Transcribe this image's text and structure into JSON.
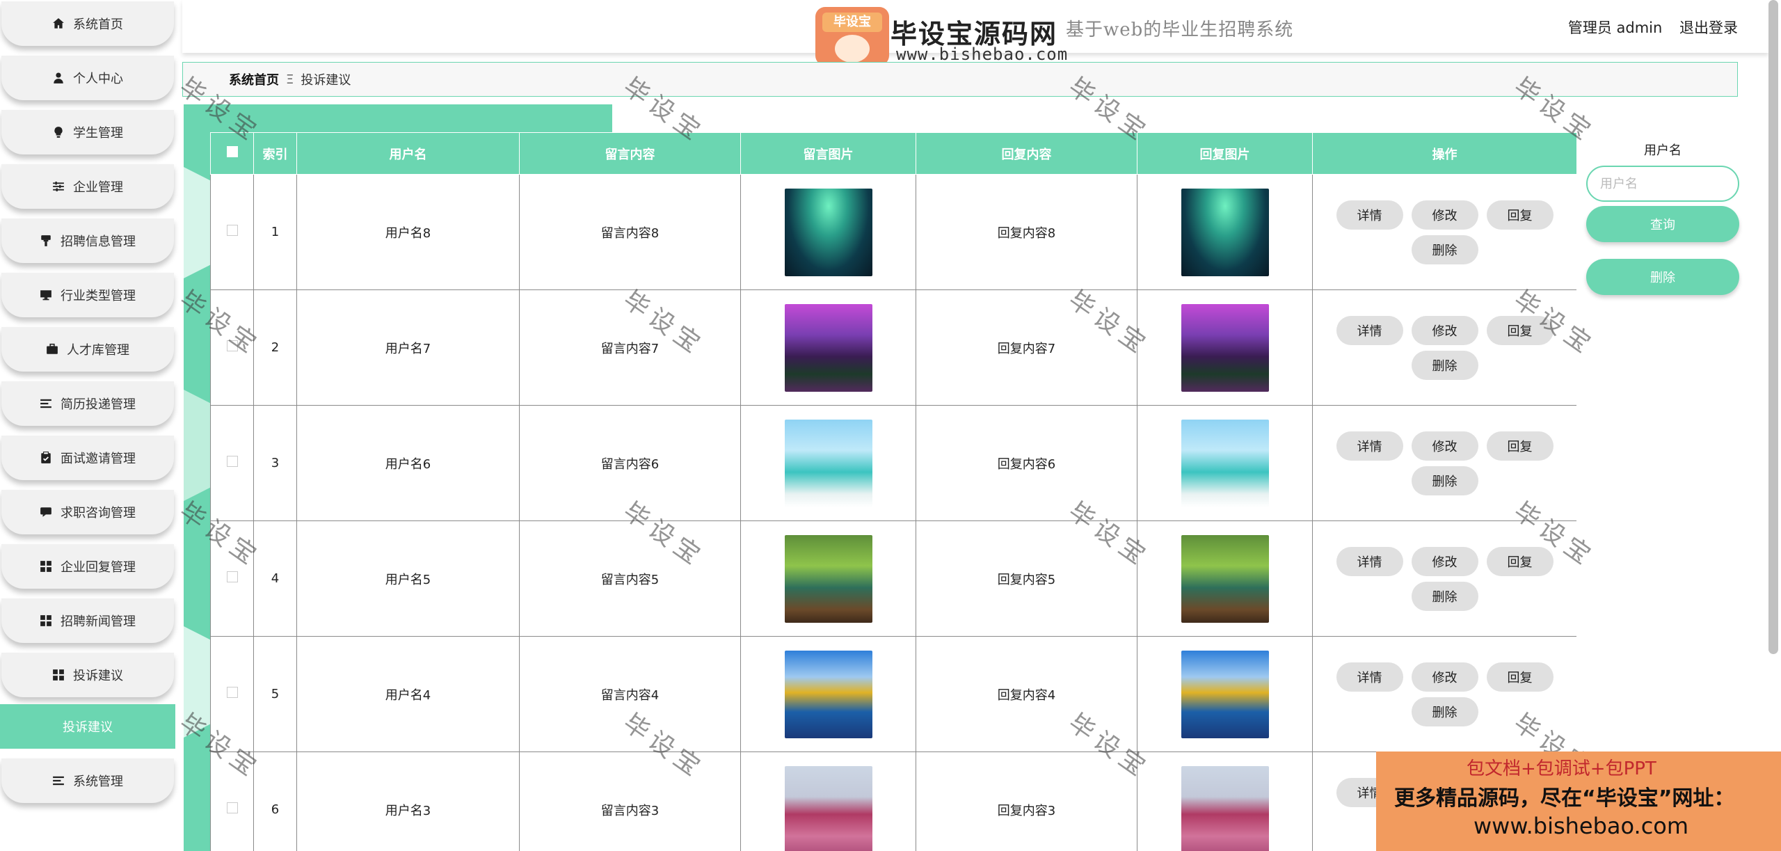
{
  "header": {
    "system_title": "基于web的毕业生招聘系统",
    "logo_badge": "毕设宝",
    "logo_text": "毕设宝源码网",
    "logo_url": "www.bishebao.com",
    "user_label": "管理员 admin",
    "logout": "退出登录"
  },
  "sidebar": {
    "items": [
      {
        "label": "系统首页",
        "icon": "home-icon"
      },
      {
        "label": "个人中心",
        "icon": "user-icon"
      },
      {
        "label": "学生管理",
        "icon": "bulb-icon"
      },
      {
        "label": "企业管理",
        "icon": "sliders-icon"
      },
      {
        "label": "招聘信息管理",
        "icon": "brush-icon"
      },
      {
        "label": "行业类型管理",
        "icon": "monitor-icon"
      },
      {
        "label": "人才库管理",
        "icon": "briefcase-icon"
      },
      {
        "label": "简历投递管理",
        "icon": "list-icon"
      },
      {
        "label": "面试邀请管理",
        "icon": "clipboard-icon"
      },
      {
        "label": "求职咨询管理",
        "icon": "chat-icon"
      },
      {
        "label": "企业回复管理",
        "icon": "grid-icon"
      },
      {
        "label": "招聘新闻管理",
        "icon": "grid-icon"
      },
      {
        "label": "投诉建议",
        "icon": "grid-icon"
      }
    ],
    "active_sub": "投诉建议",
    "last_item": {
      "label": "系统管理",
      "icon": "list-icon"
    }
  },
  "breadcrumb": {
    "home": "系统首页",
    "separator": "Ξ",
    "current": "投诉建议"
  },
  "table": {
    "columns": [
      "",
      "索引",
      "用户名",
      "留言内容",
      "留言图片",
      "回复内容",
      "回复图片",
      "操作"
    ],
    "rows": [
      {
        "index": "1",
        "username": "用户名8",
        "message": "留言内容8",
        "reply": "回复内容8",
        "img": "aurora"
      },
      {
        "index": "2",
        "username": "用户名7",
        "message": "留言内容7",
        "reply": "回复内容7",
        "img": "purple"
      },
      {
        "index": "3",
        "username": "用户名6",
        "message": "留言内容6",
        "reply": "回复内容6",
        "img": "beach"
      },
      {
        "index": "4",
        "username": "用户名5",
        "message": "留言内容5",
        "reply": "回复内容5",
        "img": "river"
      },
      {
        "index": "5",
        "username": "用户名4",
        "message": "留言内容4",
        "reply": "回复内容4",
        "img": "mountain"
      },
      {
        "index": "6",
        "username": "用户名3",
        "message": "留言内容3",
        "reply": "回复内容3",
        "img": "tree"
      }
    ],
    "actions": [
      "详情",
      "修改",
      "回复",
      "删除"
    ]
  },
  "search": {
    "label": "用户名",
    "placeholder": "用户名",
    "query_button": "查询",
    "delete_button": "删除"
  },
  "watermark": "毕设宝",
  "promo": {
    "line1": "包文档+包调试+包PPT",
    "line2": "更多精品源码，尽在“毕设宝”网址：",
    "line3": "www.bishebao.com"
  },
  "colors": {
    "accent": "#6bd6b1",
    "promo_bg": "#f29b5e",
    "promo_red": "#c1272d"
  }
}
